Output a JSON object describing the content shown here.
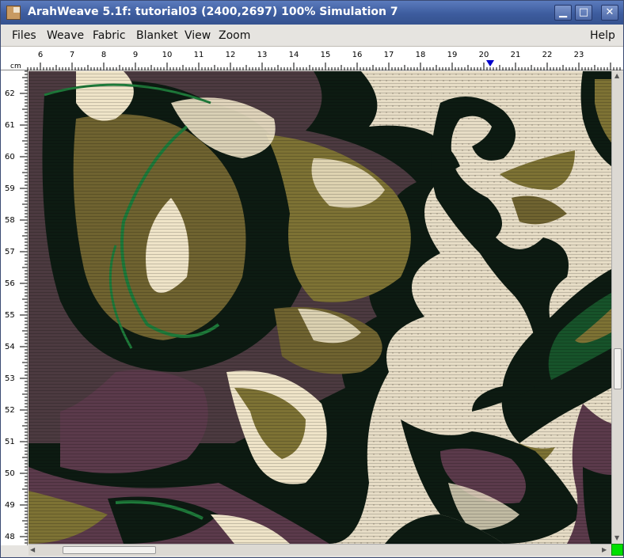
{
  "window": {
    "title": "ArahWeave 5.1f: tutorial03 (2400,2697) 100% Simulation 7",
    "icon": "app-icon",
    "controls": {
      "minimize": "▁",
      "maximize": "□",
      "close": "✕"
    }
  },
  "menubar": {
    "items": [
      "Files",
      "Weave",
      "Fabric",
      "Blanket",
      "View",
      "Zoom"
    ],
    "help": "Help"
  },
  "ruler": {
    "unit": "cm",
    "horizontal_labels": [
      "6",
      "7",
      "8",
      "9",
      "10",
      "11",
      "12",
      "13",
      "14",
      "15",
      "16",
      "17",
      "18",
      "19",
      "20",
      "21",
      "22",
      "23"
    ],
    "vertical_labels": [
      "62",
      "61",
      "60",
      "59",
      "58",
      "57",
      "56",
      "55",
      "54",
      "53",
      "52",
      "51",
      "50",
      "49",
      "48"
    ],
    "marker_position": 20.2
  },
  "colors": {
    "background": "#e7ddc6",
    "dark_green": "#0d1b12",
    "olive": "#7d7234",
    "purple": "#5b3a4b",
    "green_accent": "#1e7a3a",
    "cream": "#efe4c8",
    "marker": "#0000cc",
    "status_corner": "#00e000"
  },
  "scroll": {
    "vertical_position": 0.65,
    "horizontal_position": 0.05
  }
}
